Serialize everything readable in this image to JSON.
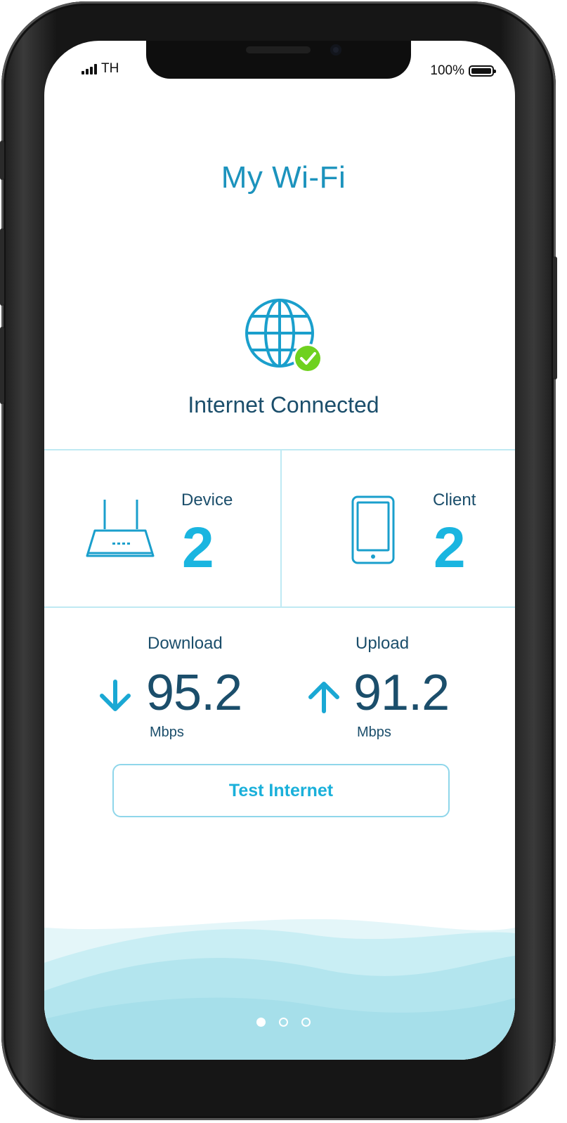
{
  "status_bar": {
    "carrier": "TH",
    "battery_percent": "100%",
    "signal_level": 4
  },
  "header": {
    "title": "My Wi-Fi"
  },
  "connection": {
    "icon": "globe-check-icon",
    "status": "Internet Connected"
  },
  "devices": {
    "icon": "router-icon",
    "label": "Device",
    "count": "2"
  },
  "clients": {
    "icon": "smartphone-icon",
    "label": "Client",
    "count": "2"
  },
  "speed": {
    "download": {
      "icon": "arrow-down-icon",
      "label": "Download",
      "value": "95.2",
      "unit": "Mbps"
    },
    "upload": {
      "icon": "arrow-up-icon",
      "label": "Upload",
      "value": "91.2",
      "unit": "Mbps"
    }
  },
  "actions": {
    "test_label": "Test Internet"
  },
  "pager": {
    "pages": 3,
    "active_index": 0
  },
  "colors": {
    "accent": "#1ab5e0",
    "title": "#1c93bd",
    "text_dark": "#1b4e6b",
    "success": "#6fd11f",
    "divider": "#bfe9f3"
  }
}
